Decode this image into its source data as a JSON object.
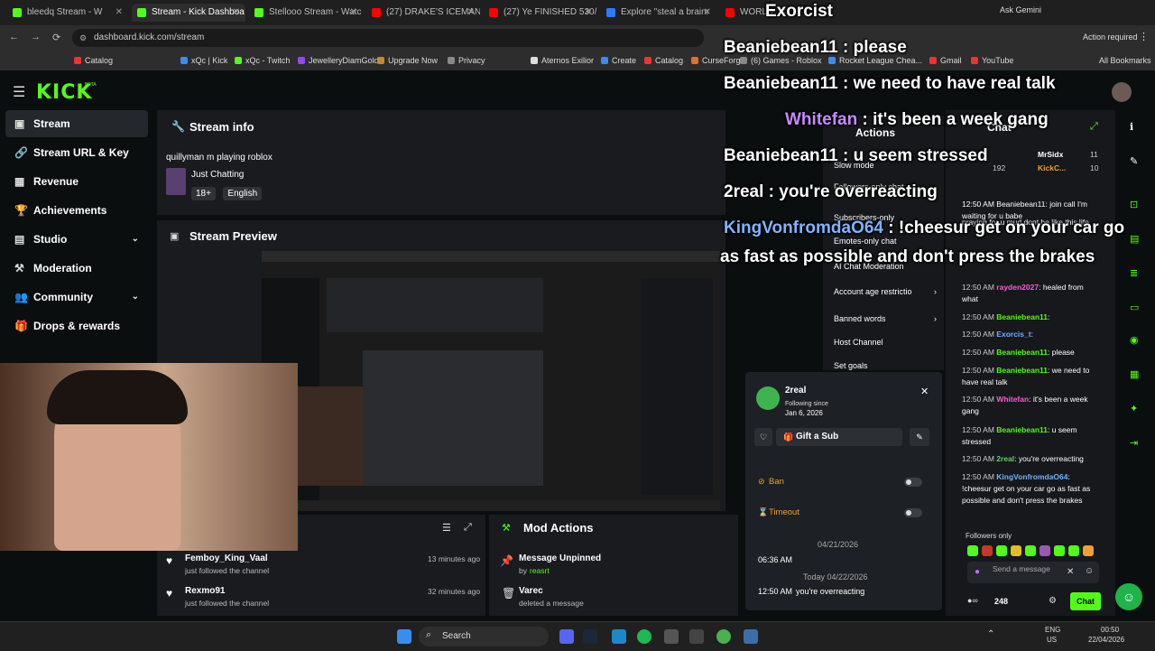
{
  "browser": {
    "tabs": [
      {
        "label": "bleedq Stream - W",
        "color": "#53fc18",
        "active": false
      },
      {
        "label": "Stream - Kick Dashboa",
        "color": "#53fc18",
        "active": true
      },
      {
        "label": "Stellooo Stream - Watc",
        "color": "#53fc18",
        "active": false
      },
      {
        "label": "(27) DRAKE'S ICEMAN",
        "color": "#ff0000",
        "active": false
      },
      {
        "label": "(27) Ye FINISHED 530/",
        "color": "#ff0000",
        "active": false
      },
      {
        "label": "Explore \"steal a brainr",
        "color": "#2b7bff",
        "active": false
      },
      {
        "label": "WORLD",
        "color": "#ff0000",
        "active": false
      }
    ],
    "url": "dashboard.kick.com/stream",
    "ask_gemini": "Ask Gemini",
    "action_required": "Action required",
    "bookmarks": [
      "Catalog",
      "xQc | Kick",
      "xQc - Twitch",
      "JewelleryDiamGold",
      "Upgrade Now",
      "Privacy",
      "Aternos Exilior",
      "Create",
      "Catalog",
      "CurseForge",
      "(6) Games - Roblox",
      "Rocket League Chea...",
      "Gmail",
      "YouTube"
    ],
    "all_bookmarks": "All Bookmarks"
  },
  "kick": {
    "logo": "KICK",
    "logo_tag": "BETA",
    "nav": [
      {
        "label": "Stream",
        "icon": "▣",
        "active": true,
        "chevron": false
      },
      {
        "label": "Stream URL & Key",
        "icon": "🔗",
        "active": false,
        "chevron": false
      },
      {
        "label": "Revenue",
        "icon": "▦",
        "active": false,
        "chevron": false
      },
      {
        "label": "Achievements",
        "icon": "🏆",
        "active": false,
        "chevron": false
      },
      {
        "label": "Studio",
        "icon": "▤",
        "active": false,
        "chevron": true
      },
      {
        "label": "Moderation",
        "icon": "⚒",
        "active": false,
        "chevron": false
      },
      {
        "label": "Community",
        "icon": "👥",
        "active": false,
        "chevron": true
      },
      {
        "label": "Drops & rewards",
        "icon": "🎁",
        "active": false,
        "chevron": false
      }
    ],
    "stream_info": {
      "title": "Stream info",
      "stream_title": "quillyman m playing roblox",
      "category": "Just Chatting",
      "tags": [
        "18+",
        "English"
      ]
    },
    "stream_preview": {
      "title": "Stream Preview"
    },
    "activity": [
      {
        "user": "Femboy_King_Vaal",
        "action": "just followed the channel",
        "time": "13 minutes ago"
      },
      {
        "user": "Rexmo91",
        "action": "just followed the channel",
        "time": "32 minutes ago"
      }
    ],
    "mod_actions": {
      "title": "Mod Actions",
      "items": [
        {
          "title": "Message Unpinned",
          "by_prefix": "by",
          "by": "reasrt"
        },
        {
          "title": "Varec",
          "by_prefix": "",
          "by": "deleted a message"
        }
      ]
    },
    "actions_menu": {
      "title": "Actions",
      "items": [
        "Slow mode",
        "Followers-only chat",
        "Subscribers-only",
        "Emotes-only chat",
        "AI Chat Moderation",
        "Account age restrictio",
        "Banned words",
        "Host Channel",
        "Set goals"
      ]
    },
    "user_card": {
      "name": "2real",
      "following_since_label": "Following since",
      "following_since": "Jan 6, 2026",
      "gift_label": "Gift a Sub",
      "ban_label": "Ban",
      "timeout_label": "Timeout",
      "date1": "04/21/2026",
      "time1": "06:36 AM",
      "date2": "Today 04/22/2026",
      "msg_time": "12:50 AM",
      "msg_text": "you're overreacting"
    },
    "chat": {
      "title": "Chat",
      "top_users": [
        {
          "name": "MrSidx",
          "count": "11"
        },
        {
          "name": "KickC...",
          "count": "10"
        }
      ],
      "top_count": "192",
      "messages": [
        {
          "time": "",
          "user": "",
          "text": "12:50 AM Beaniebean11: join call I'm waiting for u babe",
          "ucolor": "u1"
        },
        {
          "time": "",
          "user": "",
          "text": "praying for u mud dont be like this life",
          "ucolor": "u1"
        },
        {
          "time": "12:50 AM",
          "user": "rayden2027",
          "text": ": healed from what",
          "ucolor": "u2"
        },
        {
          "time": "12:50 AM",
          "user": "Beaniebean11",
          "text": ":",
          "ucolor": "u1"
        },
        {
          "time": "12:50 AM",
          "user": "Exorcis_t",
          "text": ":",
          "ucolor": "u3"
        },
        {
          "time": "12:50 AM",
          "user": "Beaniebean11",
          "text": ": please",
          "ucolor": "u1"
        },
        {
          "time": "12:50 AM",
          "user": "Beaniebean11",
          "text": ": we need to have real talk",
          "ucolor": "u1"
        },
        {
          "time": "12:50 AM",
          "user": "Whitefan",
          "text": ": it's been a week gang",
          "ucolor": "u2"
        },
        {
          "time": "12:50 AM",
          "user": "Beaniebean11",
          "text": ": u seem stressed",
          "ucolor": "u1"
        },
        {
          "time": "12:50 AM",
          "user": "2real",
          "text": ": you're overreacting",
          "ucolor": "u4"
        },
        {
          "time": "12:50 AM",
          "user": "KingVonfromdaO64",
          "text": ": !cheesur get on your car go as fast as possible and don't press the brakes",
          "ucolor": "u3"
        }
      ],
      "followers_only": "Followers only",
      "send_placeholder": "Send a message",
      "viewer_count": "248",
      "chat_button": "Chat"
    }
  },
  "overlay": [
    {
      "user": "Exorcist",
      "text": ""
    },
    {
      "user": "Beaniebean11",
      "text": " : please"
    },
    {
      "user": "Beaniebean11",
      "text": " : we need to have real talk"
    },
    {
      "user": "Whitefan",
      "text": " : it's been a week gang"
    },
    {
      "user": "Beaniebean11",
      "text": " : u seem stressed"
    },
    {
      "user": "2real",
      "text": " : you're overreacting"
    },
    {
      "user": "KingVonfromdaO64",
      "text": " : !cheesur get on your car go"
    },
    {
      "user": "",
      "text": "as fast as possible and don't press the brakes"
    }
  ],
  "taskbar": {
    "search": "Search",
    "lang": "ENG",
    "region": "US",
    "time": "00:50",
    "date": "22/04/2026"
  }
}
